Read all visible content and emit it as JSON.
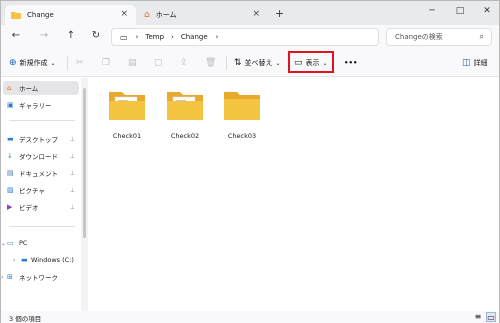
{
  "tabs": [
    {
      "label": "Change",
      "icon": "folder-icon"
    },
    {
      "label": "ホーム",
      "icon": "home-icon"
    }
  ],
  "window_controls": {
    "minimize": "─",
    "maximize": "□",
    "close": "✕"
  },
  "nav": {
    "back": "←",
    "forward": "→",
    "up": "↑",
    "refresh": "↻",
    "crumbs": [
      "Temp",
      "Change"
    ],
    "search_placeholder": "Changeの検索"
  },
  "toolbar": {
    "new_label": "新規作成",
    "sort_label": "並べ替え",
    "view_label": "表示",
    "more_label": "•••",
    "details_label": "詳細"
  },
  "sidebar": {
    "top": [
      {
        "label": "ホーム",
        "icon": "home-icon"
      },
      {
        "label": "ギャラリー",
        "icon": "gallery-icon"
      }
    ],
    "quick": [
      {
        "label": "デスクトップ",
        "icon": "desktop-icon"
      },
      {
        "label": "ダウンロード",
        "icon": "download-icon"
      },
      {
        "label": "ドキュメント",
        "icon": "document-icon"
      },
      {
        "label": "ピクチャ",
        "icon": "pictures-icon"
      },
      {
        "label": "ビデオ",
        "icon": "video-icon"
      }
    ],
    "tree": [
      {
        "label": "PC",
        "icon": "pc-icon"
      },
      {
        "label": "Windows (C:)",
        "icon": "drive-icon"
      },
      {
        "label": "ネットワーク",
        "icon": "network-icon"
      }
    ]
  },
  "files": [
    {
      "name": "Check01",
      "has_content": true
    },
    {
      "name": "Check02",
      "has_content": true
    },
    {
      "name": "Check03",
      "has_content": false
    }
  ],
  "status": {
    "item_count": "3 個の項目"
  },
  "colors": {
    "highlight": "#e0141e",
    "folder": "#f5c542",
    "folder_dark": "#e8a92c"
  }
}
